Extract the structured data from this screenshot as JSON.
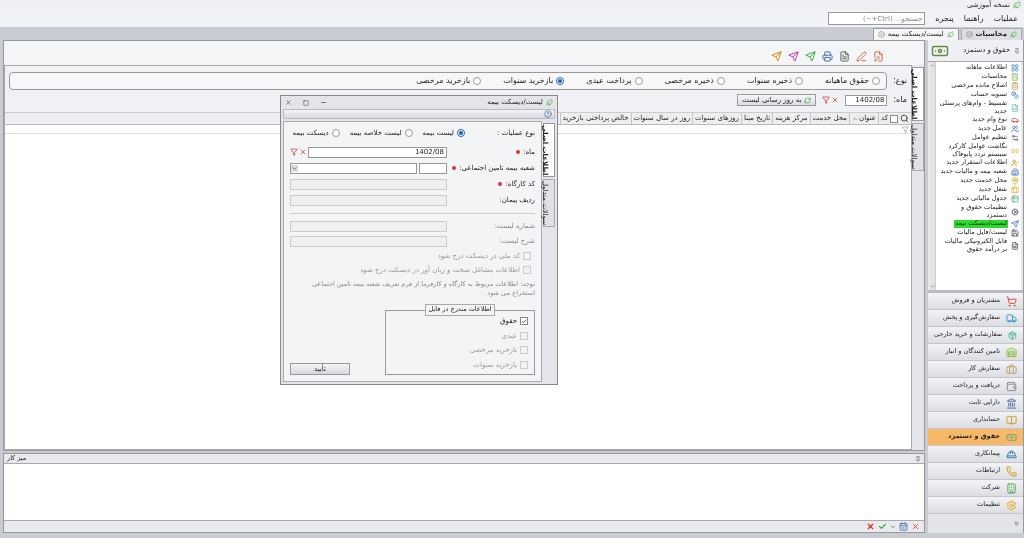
{
  "window": {
    "title": "نسخه آموزشی"
  },
  "menu": [
    "عملیات",
    "راهنما",
    "پنجره"
  ],
  "search": {
    "placeholder": "جستجو... (Ctrl+~)"
  },
  "doc_tabs": [
    {
      "label": "محاسبات",
      "selected": false
    },
    {
      "label": "لیست/دیسکت بیمه",
      "selected": true
    }
  ],
  "main": {
    "side_tabs": [
      {
        "label": "اطلاعات اصلی",
        "selected": true
      },
      {
        "label": "سوالات متداول",
        "selected": false
      }
    ],
    "type_label": "نوع:",
    "types": [
      {
        "label": "حقوق ماهیانه",
        "selected": false
      },
      {
        "label": "ذخیره سنوات",
        "selected": false
      },
      {
        "label": "ذخیره مرخصی",
        "selected": false
      },
      {
        "label": "پرداخت عیدی",
        "selected": false
      },
      {
        "label": "بازخرید سنوات",
        "selected": true
      },
      {
        "label": "بازخرید مرخصی",
        "selected": false
      }
    ],
    "month_label": "ماه:",
    "month_value": "1402/08",
    "refresh_button": "به روز رسانی لیست",
    "table": {
      "select_all_checked": false,
      "columns": [
        "کد",
        "عنوان",
        "محل خدمت",
        "مرکز هزینه",
        "تاریخ مبنا",
        "روزهای سنوات",
        "روز در سال سنوات",
        "خالص پرداختی بازخرید"
      ]
    }
  },
  "dialog": {
    "title": "لیست/دیسکت بیمه",
    "side_tabs": [
      {
        "label": "اطلاعات اصلی",
        "selected": true
      },
      {
        "label": "سوالات متداول",
        "selected": false
      }
    ],
    "operation_label": "نوع عملیات :",
    "operations": [
      {
        "label": "لیست بیمه",
        "selected": true
      },
      {
        "label": "لیست خلاصه بیمه",
        "selected": false
      },
      {
        "label": "دیسکت بیمه",
        "selected": false
      }
    ],
    "fields": [
      {
        "kind": "month",
        "label": "ماه:",
        "required": true,
        "value": "1402/08"
      },
      {
        "kind": "branch",
        "label": "شعبه بیمه تامین اجتماعی:",
        "required": true
      },
      {
        "kind": "plain",
        "label": "کد کارگاه:",
        "required": true
      },
      {
        "kind": "plain",
        "label": "ردیف پیمان:",
        "required": false
      }
    ],
    "list_fields": [
      {
        "label": "شماره لیست:"
      },
      {
        "label": "شرح لیست:"
      }
    ],
    "options": [
      {
        "label": "کد ملی در دیسکت درج شود",
        "checked": false
      },
      {
        "label": "اطلاعات مشاغل سخت و زیان آور در دیسکت درج شود",
        "checked": false
      }
    ],
    "note": "توجه: اطلاعات مربوط به کارگاه و کارفرما از فرم تعریف شعبه بیمه تامین اجتماعی استخراج می شود .",
    "file_group": {
      "title": "اطلاعات مندرج در فایل",
      "items": [
        {
          "label": "حقوق",
          "checked": true,
          "disabled": false
        },
        {
          "label": "عیدی",
          "checked": false,
          "disabled": true
        },
        {
          "label": "بازخرید مرخصی",
          "checked": false,
          "disabled": true
        },
        {
          "label": "بازخرید سنوات",
          "checked": false,
          "disabled": true
        }
      ]
    },
    "confirm_button": "تأیید"
  },
  "sidebar": {
    "title": "حقوق و دستمزد",
    "items": [
      {
        "label": "اطلاعات ماهانه",
        "selected": false
      },
      {
        "label": "محاسبات",
        "selected": false
      },
      {
        "label": "اصلاح مانده مرخصی",
        "selected": false
      },
      {
        "label": "تسویه حساب",
        "selected": false
      },
      {
        "label": "تقسیط - وام‌های پرسنلی جدید",
        "selected": false
      },
      {
        "label": "نوع وام جدید",
        "selected": false
      },
      {
        "label": "عامل جدید",
        "selected": false
      },
      {
        "label": "تنظیم عوامل",
        "selected": false
      },
      {
        "label": "نگاشت عوامل کارکرد سیستم تردد پایوفاک",
        "selected": false
      },
      {
        "label": "اطلاعات استقرار جدید",
        "selected": false
      },
      {
        "label": "شعبه بیمه و مالیات جدید",
        "selected": false
      },
      {
        "label": "محل خدمت جدید",
        "selected": false
      },
      {
        "label": "شغل جدید",
        "selected": false
      },
      {
        "label": "جدول مالیاتی جدید",
        "selected": false
      },
      {
        "label": "تنظیمات حقوق و دستمزد",
        "selected": false
      },
      {
        "label": "لیست/دیسکت بیمه",
        "selected": true
      },
      {
        "label": "لیست/فایل مالیات",
        "selected": false
      },
      {
        "label": "فایل الکترونیکی مالیات بر درآمد حقوق",
        "selected": false
      }
    ]
  },
  "modules": [
    {
      "label": "مشتریان و فروش",
      "selected": false
    },
    {
      "label": "سفارش‌گیری و پخش",
      "selected": false
    },
    {
      "label": "سفارشات و خرید خارجی",
      "selected": false
    },
    {
      "label": "تامین کنندگان و انبار",
      "selected": false
    },
    {
      "label": "سفارش کار",
      "selected": false
    },
    {
      "label": "دریافت و پرداخت",
      "selected": false
    },
    {
      "label": "دارایی ثابت",
      "selected": false
    },
    {
      "label": "حسابداری",
      "selected": false
    },
    {
      "label": "حقوق و دستمزد",
      "selected": true
    },
    {
      "label": "پیمانکاری",
      "selected": false
    },
    {
      "label": "ارتباطات",
      "selected": false
    },
    {
      "label": "شرکت",
      "selected": false
    },
    {
      "label": "تنظیمات",
      "selected": false
    }
  ],
  "workspace": {
    "title": "میز کار"
  }
}
